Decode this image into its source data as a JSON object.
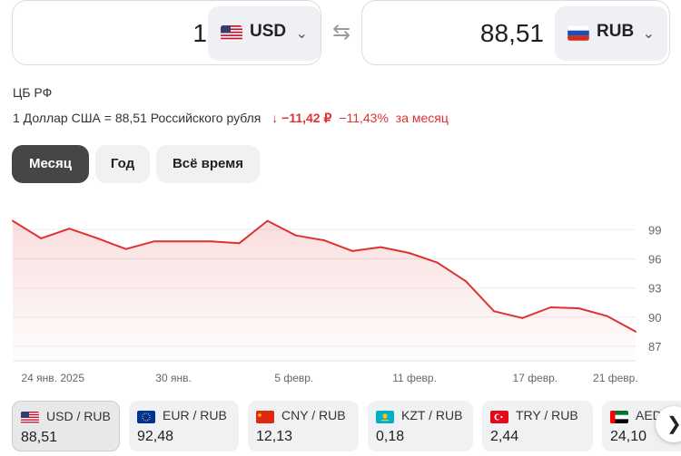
{
  "converter": {
    "from": {
      "amount": "1",
      "currency": "USD",
      "flag": "us-flag-icon"
    },
    "to": {
      "amount": "88,51",
      "currency": "RUB",
      "flag": "ru-flag-icon"
    },
    "swap_icon": "swap-arrows-icon"
  },
  "source": "ЦБ РФ",
  "rate": {
    "description": "1 Доллар США = 88,51 Российского рубля",
    "change_arrow": "↓",
    "change_abs": "−11,42 ₽",
    "change_pct": "−11,43%",
    "period": "за месяц"
  },
  "tabs": [
    {
      "label": "Месяц",
      "active": true
    },
    {
      "label": "Год",
      "active": false
    },
    {
      "label": "Всё время",
      "active": false
    }
  ],
  "chart_data": {
    "type": "area",
    "x": [
      1,
      2,
      3,
      4,
      5,
      6,
      7,
      8,
      9,
      10,
      11,
      12,
      13,
      14,
      15,
      16,
      17,
      18,
      19,
      20,
      21,
      22
    ],
    "values": [
      99.9,
      98.1,
      99.1,
      98.1,
      97.0,
      97.8,
      97.8,
      97.8,
      97.6,
      99.9,
      98.4,
      97.9,
      96.8,
      97.2,
      96.6,
      95.6,
      93.7,
      90.6,
      89.9,
      91.0,
      90.9,
      90.1
    ],
    "last_value": 88.5,
    "x_tick_labels": [
      "24 янв. 2025",
      "30 янв.",
      "5 февр.",
      "11 февр.",
      "17 февр.",
      "21 февр."
    ],
    "y_tick_labels": [
      "99",
      "96",
      "93",
      "90",
      "87"
    ],
    "y_ticks": [
      99,
      96,
      93,
      90,
      87
    ],
    "ylim": [
      85.5,
      100.8
    ],
    "grid": true,
    "line_color": "#e03131"
  },
  "pairs": [
    {
      "name": "USD / RUB",
      "value": "88,51",
      "flag": "us-flag-icon",
      "active": true
    },
    {
      "name": "EUR / RUB",
      "value": "92,48",
      "flag": "eu-flag-icon",
      "active": false
    },
    {
      "name": "CNY / RUB",
      "value": "12,13",
      "flag": "cn-flag-icon",
      "active": false
    },
    {
      "name": "KZT / RUB",
      "value": "0,18",
      "flag": "kz-flag-icon",
      "active": false
    },
    {
      "name": "TRY / RUB",
      "value": "2,44",
      "flag": "tr-flag-icon",
      "active": false
    },
    {
      "name": "AED",
      "value": "24,10",
      "flag": "ae-flag-icon",
      "active": false
    }
  ],
  "scroll_icon": "chevron-right-icon"
}
